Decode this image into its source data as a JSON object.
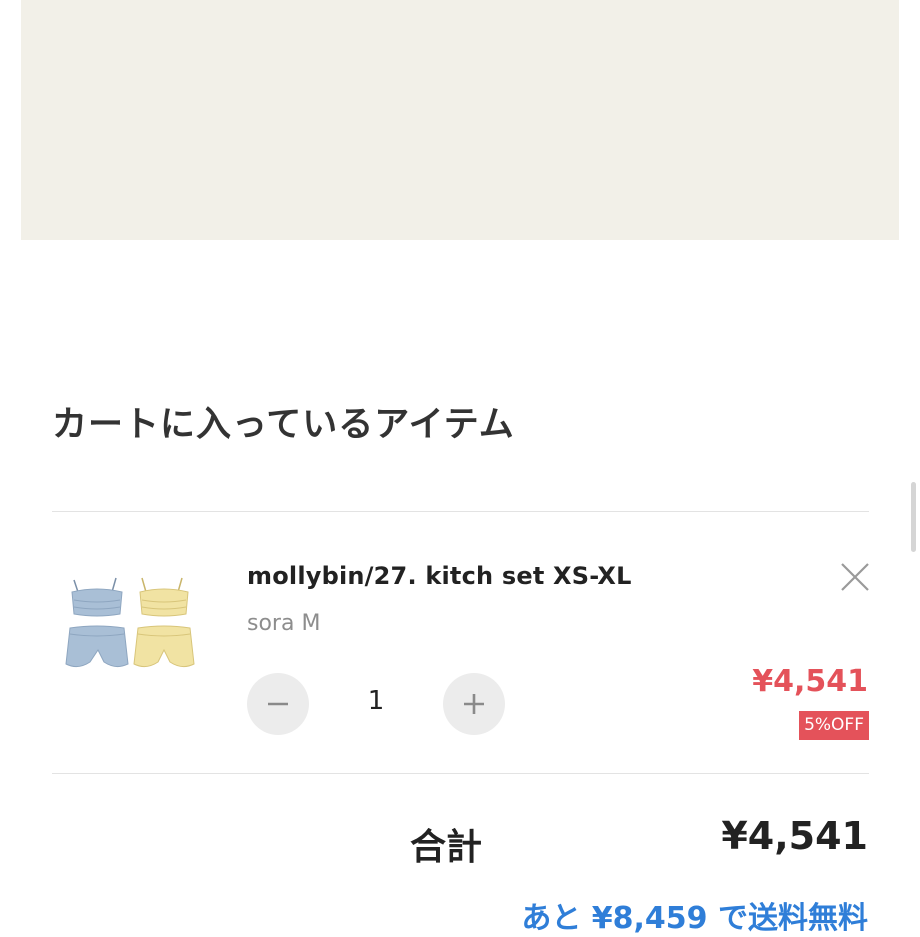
{
  "cart": {
    "title": "カートに入っているアイテム",
    "items": [
      {
        "name": "mollybin/27. kitch set XS-XL",
        "variant": "sora M",
        "quantity": "1",
        "price": "¥4,541",
        "discount": "5%OFF"
      }
    ],
    "total_label": "合計",
    "total_value": "¥4,541",
    "shipping_note": "あと ¥8,459 で送料無料"
  },
  "icons": {
    "remove": "close-icon",
    "decrease": "minus-icon",
    "increase": "plus-icon"
  },
  "colors": {
    "banner": "#f2f0e8",
    "price": "#e4525a",
    "badge": "#e4525a",
    "link": "#2f7ed8",
    "button": "#ececec"
  }
}
